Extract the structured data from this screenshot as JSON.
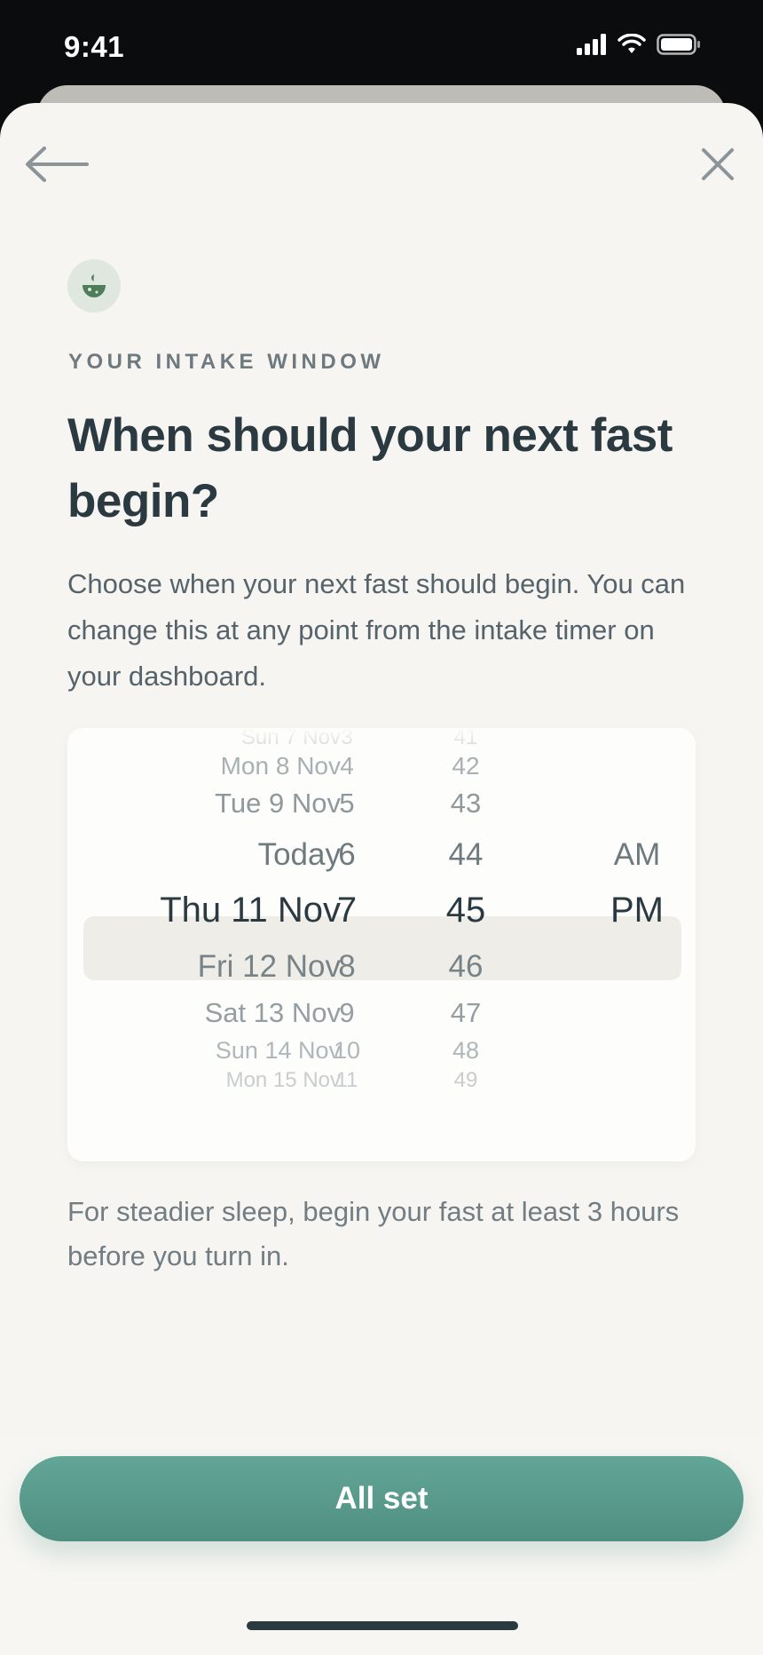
{
  "status_bar": {
    "time": "9:41"
  },
  "header": {
    "eyebrow": "YOUR INTAKE WINDOW",
    "title": "When should your next fast begin?"
  },
  "description": "Choose when your next fast should begin. You can change this at any point from the intake timer on your dashboard.",
  "picker": {
    "rows": [
      {
        "date": "Sun 7 Nov",
        "hour": "3",
        "minute": "41",
        "ampm": "",
        "color": "#c9cdcf",
        "size": 24
      },
      {
        "date": "Mon 8 Nov",
        "hour": "4",
        "minute": "42",
        "ampm": "",
        "color": "#a9b0b3",
        "size": 28
      },
      {
        "date": "Tue 9 Nov",
        "hour": "5",
        "minute": "43",
        "ampm": "",
        "color": "#8f989c",
        "size": 31
      },
      {
        "date": "Today",
        "hour": "6",
        "minute": "44",
        "ampm": "AM",
        "color": "#6f7a7f",
        "size": 35
      },
      {
        "date": "Thu 11 Nov",
        "hour": "7",
        "minute": "45",
        "ampm": "PM",
        "color": "#2b3a41",
        "size": 40
      },
      {
        "date": "Fri 12 Nov",
        "hour": "8",
        "minute": "46",
        "ampm": "",
        "color": "#788388",
        "size": 35
      },
      {
        "date": "Sat 13 Nov",
        "hour": "9",
        "minute": "47",
        "ampm": "",
        "color": "#959ea2",
        "size": 31
      },
      {
        "date": "Sun 14 Nov",
        "hour": "10",
        "minute": "48",
        "ampm": "",
        "color": "#b0b7ba",
        "size": 27
      },
      {
        "date": "Mon 15 Nov",
        "hour": "11",
        "minute": "49",
        "ampm": "",
        "color": "#c9cdcf",
        "size": 24
      }
    ],
    "selected": {
      "date": "Thu 11 Nov",
      "hour": "7",
      "minute": "45",
      "ampm": "PM"
    }
  },
  "hint": "For steadier sleep, begin your fast at least 3 hours before you turn in.",
  "cta": {
    "label": "All set",
    "color": "#5a9d8f"
  },
  "icons": {
    "back": "arrow-left-icon",
    "close": "close-icon",
    "badge": "bowl-icon"
  },
  "colors": {
    "sheet": "#f6f5f1",
    "text_dark": "#2b3a41",
    "accent": "#5a9d8f"
  }
}
